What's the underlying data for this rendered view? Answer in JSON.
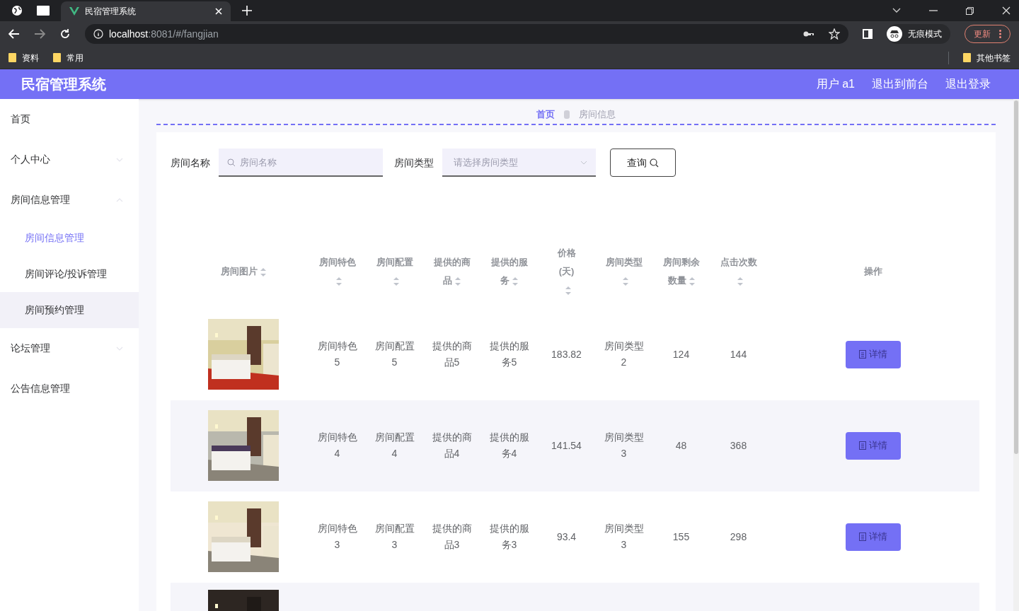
{
  "browser": {
    "tab": {
      "title": "民宿管理系统"
    },
    "url": {
      "host": "localhost",
      "path": ":8081/#/fangjian"
    },
    "profile": "无痕模式",
    "update": "更新",
    "bookmarks": [
      "资料",
      "常用"
    ],
    "other_bookmarks": "其他书签"
  },
  "header": {
    "title": "民宿管理系统",
    "links": [
      "用户 a1",
      "退出到前台",
      "退出登录"
    ]
  },
  "sidebar": {
    "items": [
      {
        "label": "首页",
        "expandable": false
      },
      {
        "label": "个人中心",
        "expandable": true,
        "expanded": false
      },
      {
        "label": "房间信息管理",
        "expandable": true,
        "expanded": true,
        "children": [
          {
            "label": "房间信息管理",
            "selected": true,
            "highlighted": false
          },
          {
            "label": "房间评论/投诉管理",
            "selected": false,
            "highlighted": false
          },
          {
            "label": "房间预约管理",
            "selected": false,
            "highlighted": true
          }
        ]
      },
      {
        "label": "论坛管理",
        "expandable": true,
        "expanded": false
      },
      {
        "label": "公告信息管理",
        "expandable": false
      }
    ]
  },
  "breadcrumb": [
    {
      "label": "首页",
      "selected": true
    },
    {
      "label": "房间信息",
      "selected": false
    }
  ],
  "filters": {
    "name_label": "房间名称",
    "name_placeholder": "房间名称",
    "type_label": "房间类型",
    "type_placeholder": "请选择房间类型",
    "search_button": "查询"
  },
  "table": {
    "columns": [
      {
        "label": "房间图片",
        "sortable": true
      },
      {
        "label": "房间特色",
        "sortable": true
      },
      {
        "label": "房间配置",
        "sortable": true
      },
      {
        "label": "提供的商品",
        "sortable": true
      },
      {
        "label": "提供的服务",
        "sortable": true
      },
      {
        "label": "价格(天)",
        "sortable": true
      },
      {
        "label": "房间类型",
        "sortable": true
      },
      {
        "label": "房间剩余数量",
        "sortable": true
      },
      {
        "label": "点击次数",
        "sortable": true
      },
      {
        "label": "操作",
        "sortable": false
      }
    ],
    "rows": [
      {
        "cells": [
          {
            "kind": "picture"
          },
          {
            "kind": "text",
            "text": "房间特色5"
          },
          {
            "kind": "text",
            "text": "房间配置5"
          },
          {
            "kind": "text",
            "text": "提供的商品5"
          },
          {
            "kind": "text",
            "text": "提供的服务5"
          },
          {
            "kind": "text",
            "text": "183.82"
          },
          {
            "kind": "text",
            "text": "房间类型2"
          },
          {
            "kind": "text",
            "text": "124"
          },
          {
            "kind": "text",
            "text": "144"
          },
          {
            "kind": "button",
            "text": "详情"
          }
        ]
      },
      {
        "cells": [
          {
            "kind": "picture"
          },
          {
            "kind": "text",
            "text": "房间特色4"
          },
          {
            "kind": "text",
            "text": "房间配置4"
          },
          {
            "kind": "text",
            "text": "提供的商品4"
          },
          {
            "kind": "text",
            "text": "提供的服务4"
          },
          {
            "kind": "text",
            "text": "141.54"
          },
          {
            "kind": "text",
            "text": "房间类型3"
          },
          {
            "kind": "text",
            "text": "48"
          },
          {
            "kind": "text",
            "text": "368"
          },
          {
            "kind": "button",
            "text": "详情"
          }
        ]
      },
      {
        "cells": [
          {
            "kind": "picture"
          },
          {
            "kind": "text",
            "text": "房间特色3"
          },
          {
            "kind": "text",
            "text": "房间配置3"
          },
          {
            "kind": "text",
            "text": "提供的商品3"
          },
          {
            "kind": "text",
            "text": "提供的服务3"
          },
          {
            "kind": "text",
            "text": "93.4"
          },
          {
            "kind": "text",
            "text": "房间类型3"
          },
          {
            "kind": "text",
            "text": "155"
          },
          {
            "kind": "text",
            "text": "298"
          },
          {
            "kind": "button",
            "text": "详情"
          }
        ]
      },
      {
        "cells": [
          {
            "kind": "picture"
          }
        ]
      }
    ]
  }
}
